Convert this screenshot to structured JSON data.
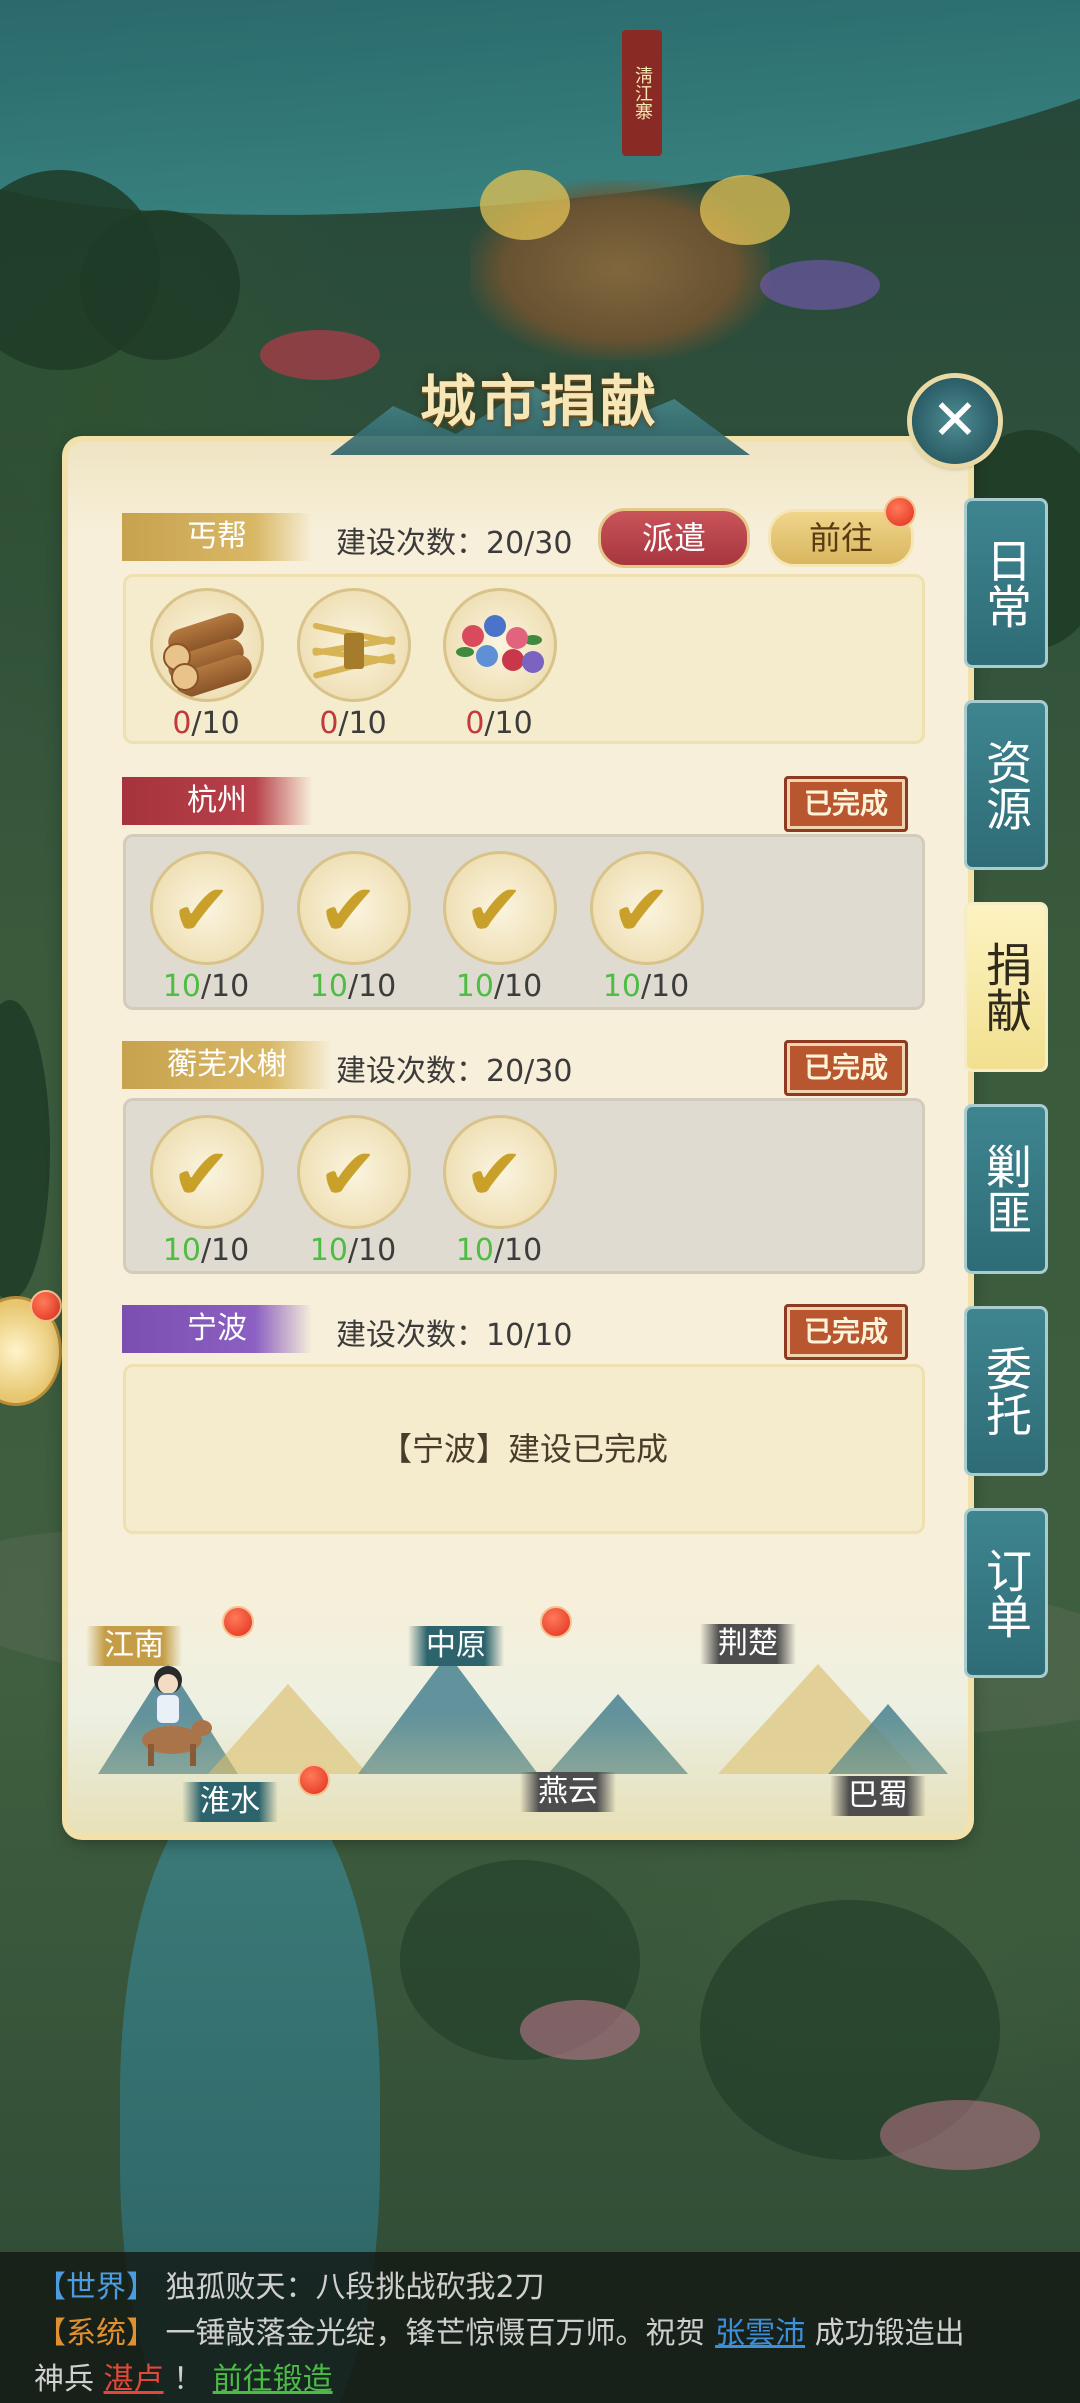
{
  "map": {
    "banner_text": "淸江寨"
  },
  "panel": {
    "title": "城市捐献",
    "close_glyph": "✕"
  },
  "rows": [
    {
      "name": "丐帮",
      "build_text": "建设次数：20/30",
      "dispatch_label": "派遣",
      "go_label": "前往",
      "items": [
        {
          "icon": "wood-logs-icon",
          "have": "0",
          "need": "/10"
        },
        {
          "icon": "hay-bundle-icon",
          "have": "0",
          "need": "/10"
        },
        {
          "icon": "flowers-icon",
          "have": "0",
          "need": "/10"
        }
      ]
    },
    {
      "name": "杭州",
      "status": "已完成",
      "items": [
        {
          "have": "10",
          "need": "/10"
        },
        {
          "have": "10",
          "need": "/10"
        },
        {
          "have": "10",
          "need": "/10"
        },
        {
          "have": "10",
          "need": "/10"
        }
      ]
    },
    {
      "name": "蘅芜水榭",
      "build_text": "建设次数：20/30",
      "status": "已完成",
      "items": [
        {
          "have": "10",
          "need": "/10"
        },
        {
          "have": "10",
          "need": "/10"
        },
        {
          "have": "10",
          "need": "/10"
        }
      ]
    },
    {
      "name": "宁波",
      "build_text": "建设次数：10/10",
      "status": "已完成",
      "message": "【宁波】建设已完成"
    }
  ],
  "check_glyph": "✔",
  "side_tabs": [
    "日常",
    "资源",
    "捐献",
    "剿匪",
    "委托",
    "订单"
  ],
  "active_tab": "捐献",
  "regions": [
    "江南",
    "中原",
    "荆楚",
    "淮水",
    "燕云",
    "巴蜀"
  ],
  "chat": {
    "line1": {
      "channel": "【世界】",
      "text": "独孤败天：八段挑战砍我2刀"
    },
    "line2": {
      "channel": "【系统】",
      "text_a": "一锤敲落金光绽，锋芒惊慑百万师。祝贺 ",
      "player": "张雲沛",
      "text_b": " 成功锻造出"
    },
    "line3": {
      "text_a": "神兵 ",
      "weapon": "湛卢",
      "text_b": " ！   ",
      "link": "前往锻造"
    }
  },
  "colors": {
    "panel_bg": "#f7efd9",
    "tab_teal": "#2e6c76",
    "tab_active": "#f1e08f",
    "stamp": "#b8572f",
    "count_red": "#c0393b",
    "count_green": "#4fbd44"
  }
}
